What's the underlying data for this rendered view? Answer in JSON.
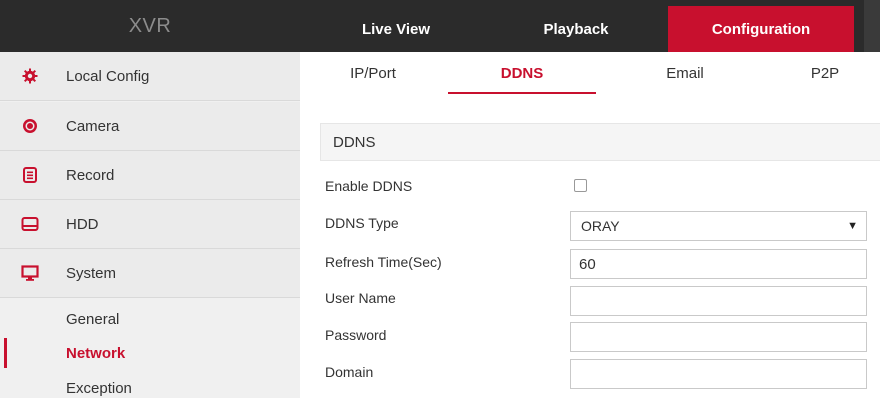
{
  "header": {
    "logo": "XVR",
    "nav": [
      {
        "label": "Live View"
      },
      {
        "label": "Playback"
      },
      {
        "label": "Configuration"
      }
    ]
  },
  "sidebar": {
    "items": [
      {
        "label": "Local Config",
        "icon": "gear-icon"
      },
      {
        "label": "Camera",
        "icon": "camera-icon"
      },
      {
        "label": "Record",
        "icon": "record-icon"
      },
      {
        "label": "HDD",
        "icon": "hdd-icon"
      },
      {
        "label": "System",
        "icon": "monitor-icon"
      }
    ],
    "subitems": [
      {
        "label": "General"
      },
      {
        "label": "Network"
      },
      {
        "label": "Exception"
      }
    ]
  },
  "tabs": [
    {
      "label": "IP/Port"
    },
    {
      "label": "DDNS"
    },
    {
      "label": "Email"
    },
    {
      "label": "P2P"
    }
  ],
  "form": {
    "section_title": "DDNS",
    "enable_label": "Enable DDNS",
    "type_label": "DDNS Type",
    "type_value": "ORAY",
    "refresh_label": "Refresh Time(Sec)",
    "refresh_value": "60",
    "username_label": "User Name",
    "username_value": "",
    "password_label": "Password",
    "password_value": "",
    "domain_label": "Domain",
    "domain_value": ""
  },
  "colors": {
    "accent": "#c8102e",
    "topbar": "#2b2b2b",
    "sidebar": "#ebebeb"
  }
}
